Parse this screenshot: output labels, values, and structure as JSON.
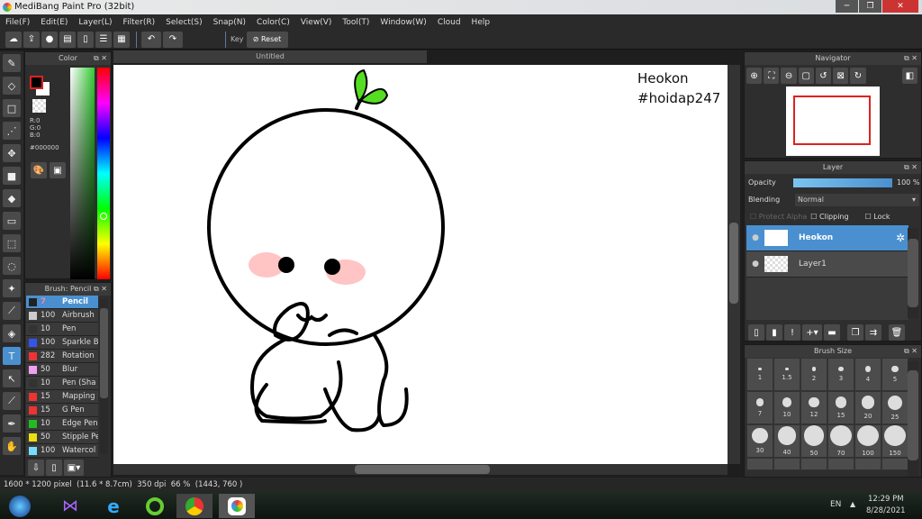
{
  "window": {
    "title": "MediBang Paint Pro (32bit)",
    "minimize": "─",
    "maximize": "❐",
    "close": "✕"
  },
  "menu": [
    "File(F)",
    "Edit(E)",
    "Layer(L)",
    "Filter(R)",
    "Select(S)",
    "Snap(N)",
    "Color(C)",
    "View(V)",
    "Tool(T)",
    "Window(W)",
    "Cloud",
    "Help"
  ],
  "toolbar": {
    "key_label": "Key",
    "reset_label": "Reset"
  },
  "color_panel": {
    "title": "Color",
    "r": "R:0",
    "g": "G:0",
    "b": "B:0",
    "hex": "#000000",
    "fg": "#000000",
    "bg": "#ffffff"
  },
  "brush_panel": {
    "title": "Brush: Pencil",
    "items": [
      {
        "size": "7",
        "name": "Pencil",
        "color": "#222222"
      },
      {
        "size": "100",
        "name": "Airbrush",
        "color": "#cccccc"
      },
      {
        "size": "10",
        "name": "Pen",
        "color": "#333333"
      },
      {
        "size": "100",
        "name": "Sparkle B",
        "color": "#3355ee"
      },
      {
        "size": "282",
        "name": "Rotation",
        "color": "#ee3333"
      },
      {
        "size": "50",
        "name": "Blur",
        "color": "#f0a0f0"
      },
      {
        "size": "10",
        "name": "Pen (Sha",
        "color": "#333333"
      },
      {
        "size": "15",
        "name": "Mapping P",
        "color": "#ee3333"
      },
      {
        "size": "15",
        "name": "G Pen",
        "color": "#ee3333"
      },
      {
        "size": "10",
        "name": "Edge Pen",
        "color": "#22bb22"
      },
      {
        "size": "50",
        "name": "Stipple Pe",
        "color": "#eedd11"
      },
      {
        "size": "100",
        "name": "Watercol",
        "color": "#77ddff"
      }
    ]
  },
  "document": {
    "tab": "Untitled",
    "watermark_line1": "Heokon",
    "watermark_line2": "#hoidap247"
  },
  "navigator": {
    "title": "Navigator"
  },
  "layer_panel": {
    "title": "Layer",
    "opacity_label": "Opacity",
    "opacity_value": "100 %",
    "opacity": 100,
    "blending_label": "Blending",
    "blending_value": "Normal",
    "protect_alpha": "Protect Alpha",
    "clipping": "Clipping",
    "lock": "Lock",
    "layers": [
      {
        "name": "Heokon",
        "selected": true
      },
      {
        "name": "Layer1",
        "selected": false
      }
    ]
  },
  "brush_size_panel": {
    "title": "Brush Size",
    "sizes": [
      "1",
      "1.5",
      "2",
      "3",
      "4",
      "5",
      "7",
      "10",
      "12",
      "15",
      "20",
      "25",
      "30",
      "40",
      "50",
      "70",
      "100",
      "150"
    ]
  },
  "status": {
    "size": "1600 * 1200 pixel",
    "physical": "(11.6 * 8.7cm)",
    "dpi": "350 dpi",
    "zoom": "66 %",
    "coords": "(1443, 760 )"
  },
  "taskbar": {
    "lang": "EN",
    "time": "12:29 PM",
    "date": "8/28/2021"
  },
  "colors": {
    "accent": "#4a90d0",
    "panel": "#2e2e2e"
  }
}
